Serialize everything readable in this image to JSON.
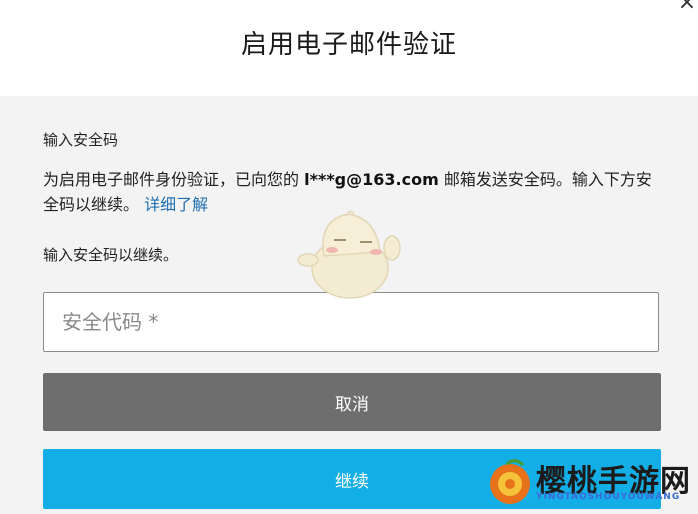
{
  "dialog": {
    "title": "启用电子邮件验证",
    "close_symbol": "×"
  },
  "content": {
    "label_enter_code": "输入安全码",
    "description_prefix": "为启用电子邮件身份验证，已向您的 ",
    "email_masked": "l***g@163.com",
    "description_suffix": " 邮箱发送安全码。输入下方安全码以继续。",
    "learn_more_link": "详细了解",
    "label_continue_prompt": "输入安全码以继续。"
  },
  "form": {
    "code_input_placeholder": "安全代码 *",
    "code_input_value": ""
  },
  "buttons": {
    "cancel_label": "取消",
    "continue_label": "继续"
  },
  "watermark": {
    "text": "樱桃手游网",
    "subtext": "YINGTAOSHOUYOUWANG"
  },
  "colors": {
    "content_background": "#f3f3f3",
    "cancel_button": "#6e6e6e",
    "continue_button": "#13aee6",
    "link": "#1f6fb2"
  },
  "icons": {
    "close": "close-icon",
    "mascot": "mascot-icon",
    "watermark_logo": "cherry-logo-icon"
  }
}
